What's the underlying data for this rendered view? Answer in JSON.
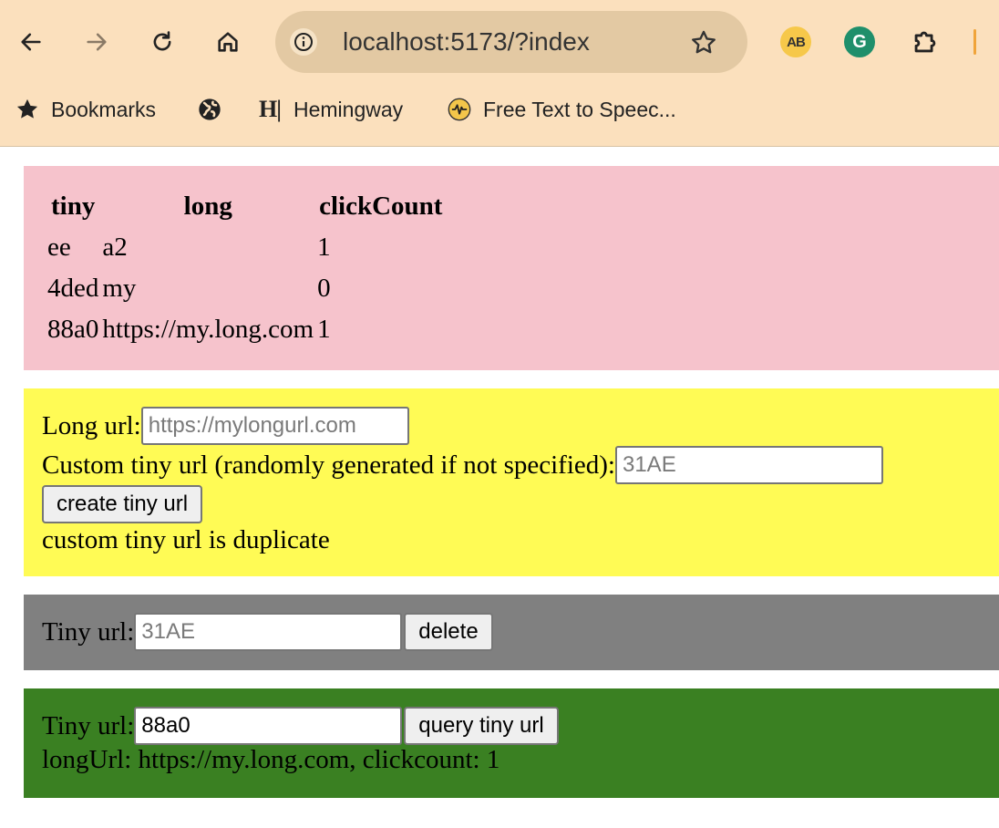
{
  "browser": {
    "url": "localhost:5173/?index",
    "bookmarks": [
      {
        "label": "Bookmarks",
        "icon": "star-icon"
      },
      {
        "label": "",
        "icon": "globe-icon"
      },
      {
        "label": "Hemingway",
        "icon": "hemingway-icon",
        "badge": "H|"
      },
      {
        "label": "Free Text to Speec...",
        "icon": "speech-icon"
      }
    ],
    "extensions": {
      "ab": "AB",
      "g": "G"
    }
  },
  "url_table": {
    "headers": [
      "tiny",
      "long",
      "clickCount"
    ],
    "rows": [
      [
        "ee",
        "a2",
        "1"
      ],
      [
        "4ded",
        "my",
        "0"
      ],
      [
        "88a0",
        "https://my.long.com",
        "1"
      ]
    ],
    "background": "#f6c3cc"
  },
  "create_form": {
    "long_label": "Long url:",
    "long_placeholder": "https://mylongurl.com",
    "custom_label": "Custom tiny url (randomly generated if not specified):",
    "custom_placeholder": "31AE",
    "button_label": "create tiny url",
    "message": "custom tiny url is duplicate",
    "background": "#fffb55"
  },
  "delete_form": {
    "label": "Tiny url:",
    "placeholder": "31AE",
    "button_label": "delete",
    "background": "#808080"
  },
  "query_form": {
    "label": "Tiny url:",
    "value": "88a0",
    "button_label": "query tiny url",
    "result": "longUrl: https://my.long.com, clickcount: 1",
    "background": "#3a8022"
  }
}
